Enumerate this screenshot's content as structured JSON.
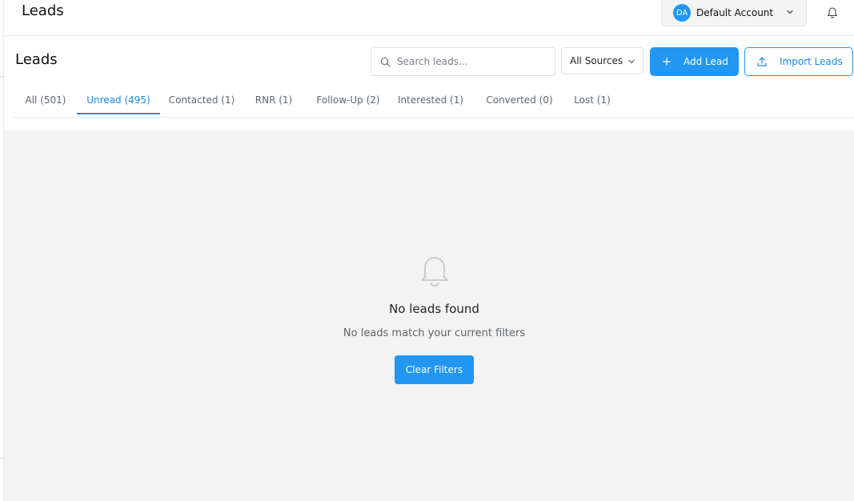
{
  "topbar": {
    "title": "Leads",
    "account": {
      "initials": "DA",
      "name": "Default Account"
    }
  },
  "header": {
    "title": "Leads",
    "search_placeholder": "Search leads...",
    "source_filter": "All Sources",
    "add_button": "Add Lead",
    "import_button": "Import Leads"
  },
  "tabs": [
    {
      "label": "All (501)",
      "active": false
    },
    {
      "label": "Unread (495)",
      "active": true
    },
    {
      "label": "Contacted (1)",
      "active": false
    },
    {
      "label": "RNR (1)",
      "active": false
    },
    {
      "label": "Follow-Up (2)",
      "active": false
    },
    {
      "label": "Interested (1)",
      "active": false
    },
    {
      "label": "Converted (0)",
      "active": false
    },
    {
      "label": "Lost (1)",
      "active": false
    }
  ],
  "empty_state": {
    "icon": "bell-icon",
    "title": "No leads found",
    "subtitle": "No leads match your current filters",
    "button": "Clear Filters"
  },
  "colors": {
    "accent": "#2196f3",
    "background": "#f3f3f3"
  }
}
